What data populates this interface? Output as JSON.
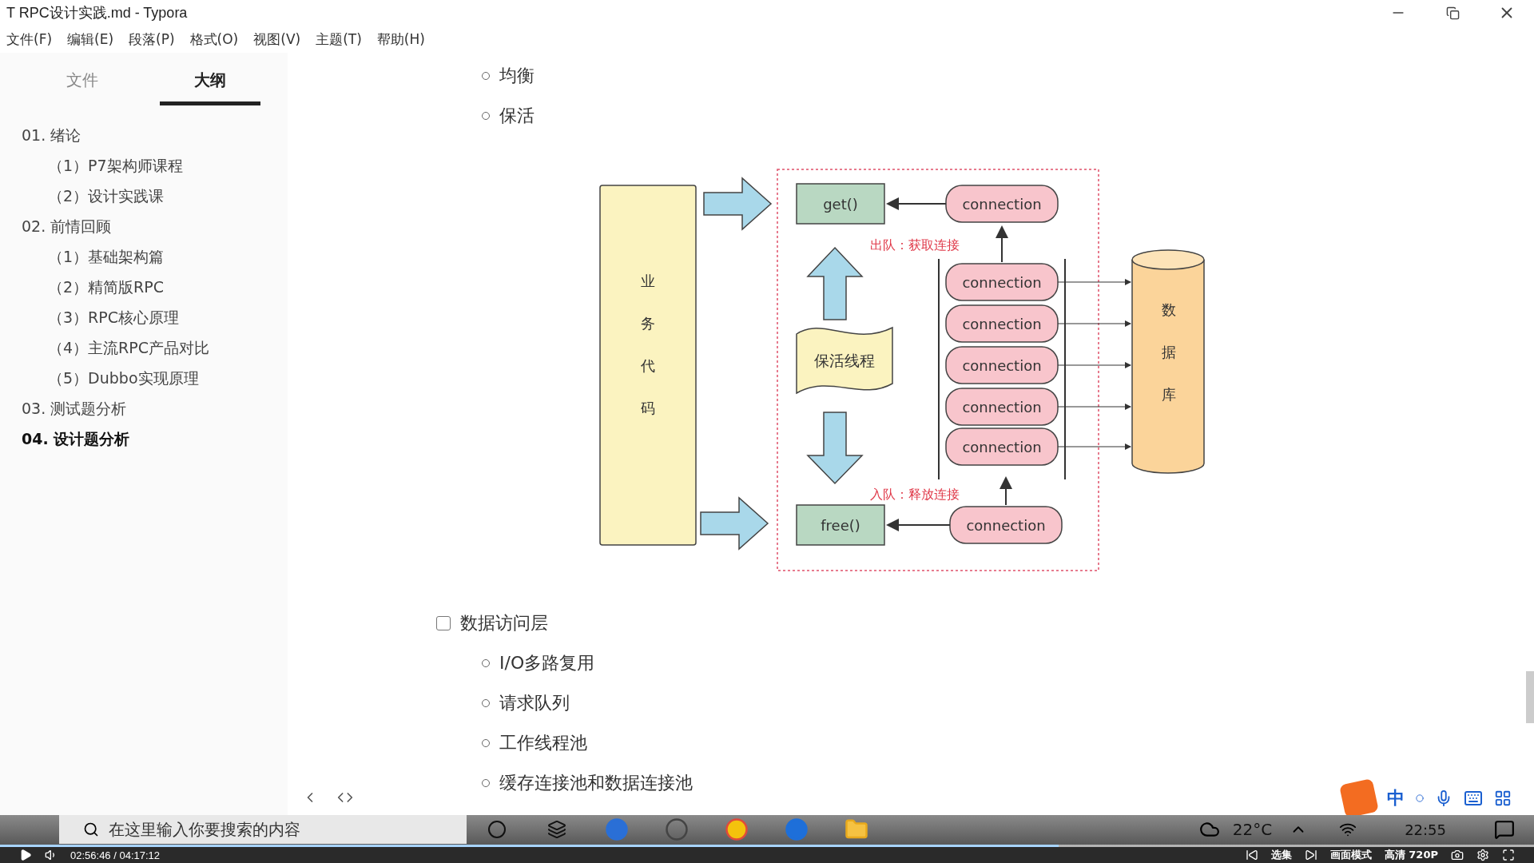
{
  "window": {
    "title": "T  RPC设计实践.md - Typora"
  },
  "menu": [
    "文件(F)",
    "编辑(E)",
    "段落(P)",
    "格式(O)",
    "视图(V)",
    "主题(T)",
    "帮助(H)"
  ],
  "sidebar": {
    "tabs": [
      {
        "label": "文件",
        "selected": false
      },
      {
        "label": "大纲",
        "selected": true
      }
    ],
    "outline": [
      {
        "label": "01. 绪论",
        "selected": false,
        "children": [
          {
            "label": "（1）P7架构师课程",
            "selected": false
          },
          {
            "label": "（2）设计实践课",
            "selected": false
          }
        ]
      },
      {
        "label": "02. 前情回顾",
        "selected": false,
        "children": [
          {
            "label": "（1）基础架构篇",
            "selected": false
          },
          {
            "label": "（2）精简版RPC",
            "selected": false
          },
          {
            "label": "（3）RPC核心原理",
            "selected": false
          },
          {
            "label": "（4）主流RPC产品对比",
            "selected": false
          },
          {
            "label": "（5）Dubbo实现原理",
            "selected": false
          }
        ]
      },
      {
        "label": "03. 测试题分析",
        "selected": false
      },
      {
        "label": "04. 设计题分析",
        "selected": true
      }
    ]
  },
  "content": {
    "top_items": [
      "均衡",
      "保活"
    ],
    "diagram": {
      "business_code": "业务代码",
      "get": "get()",
      "free": "free()",
      "top_connection": "connection",
      "dequeue_label": "出队：获取连接",
      "keepalive_thread": "保活线程",
      "pool": [
        "connection",
        "connection",
        "connection",
        "connection",
        "connection"
      ],
      "enqueue_label": "入队：释放连接",
      "bottom_connection": "connection",
      "database": "数据库"
    },
    "task": {
      "text": "数据访问层",
      "checked": false,
      "items": [
        "I/O多路复用",
        "请求队列",
        "工作线程池",
        "缓存连接池和数据连接池"
      ]
    }
  },
  "ime": {
    "mode": "中"
  },
  "taskbar": {
    "search_placeholder": "在这里输入你要搜索的内容",
    "temperature": "22°C",
    "clock": "22:55"
  },
  "player": {
    "time": "02:56:46 / 04:17:12",
    "level": 0.69,
    "episodes": "选集",
    "picture_mode": "画面模式",
    "quality": "高清 720P"
  }
}
